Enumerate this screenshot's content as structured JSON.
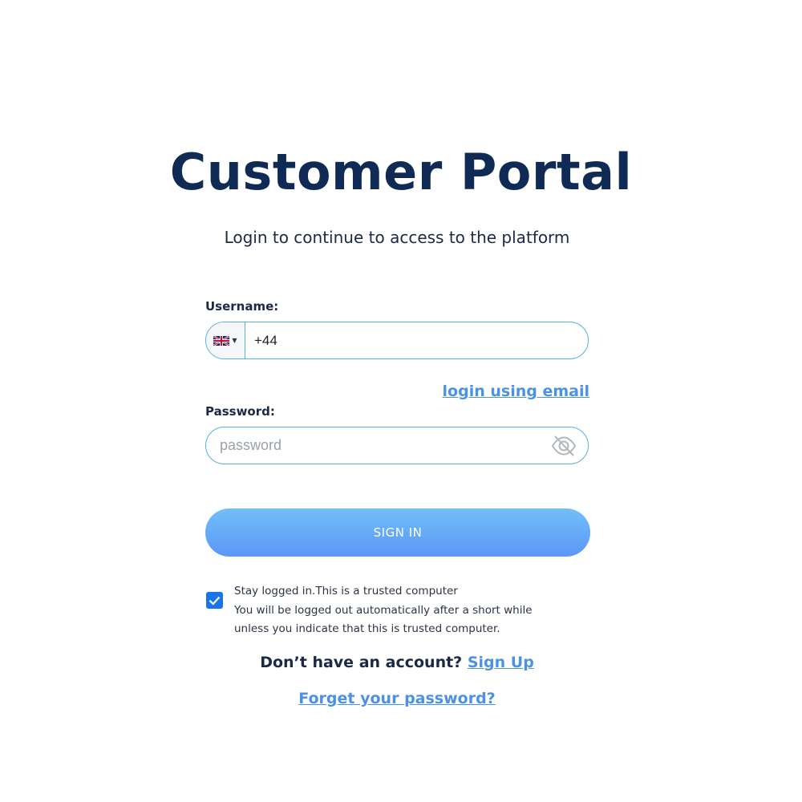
{
  "header": {
    "title": "Customer Portal",
    "subtitle": "Login to continue to access to the platform"
  },
  "form": {
    "username_label": "Username:",
    "country_flag": "uk-flag-icon",
    "phone_value": "+44",
    "login_email_link": "login using email",
    "password_label": "Password:",
    "password_placeholder": "password",
    "password_visibility_icon": "eye-slash-icon",
    "signin_label": "SIGN IN"
  },
  "stay_logged": {
    "checked": true,
    "line1": "Stay logged in.This is a trusted computer",
    "line2": "You will be logged out automatically after a short while",
    "line3": "unless you indicate that this is trusted computer."
  },
  "footer": {
    "no_account_text": "Don’t have an account?",
    "signup_link": "Sign Up",
    "forgot_link": "Forget your password?"
  },
  "colors": {
    "title": "#0f2a55",
    "link": "#4b92e6",
    "field_border": "#54b2de",
    "button_top": "#72bef9",
    "button_bottom": "#5b97f5",
    "checkbox": "#1a73e8"
  }
}
